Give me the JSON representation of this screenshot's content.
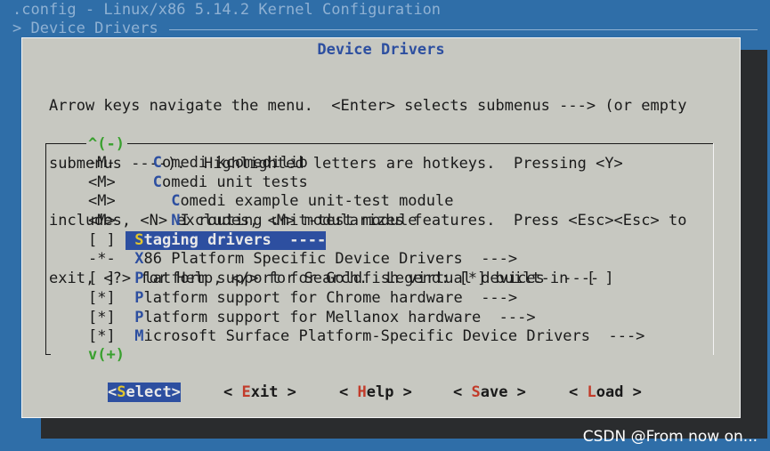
{
  "window": {
    "title": ".config - Linux/x86 5.14.2 Kernel Configuration",
    "breadcrumb": "> Device Drivers"
  },
  "dialog": {
    "title": "Device Drivers",
    "help_lines": [
      "Arrow keys navigate the menu.  <Enter> selects submenus ---> (or empty",
      "submenus ----).  Highlighted letters are hotkeys.  Pressing <Y>",
      "includes, <N> excludes, <M> modularizes features.  Press <Esc><Esc> to",
      "exit, <?> for Help, </> for Search.  Legend: [*] built-in  [ ]"
    ],
    "scroll_up": "^(-)",
    "scroll_down": "v(+)",
    "items": [
      {
        "symbol": "-M-",
        "indent": "   ",
        "hotkey": "C",
        "rest": "omedi kcomedilib",
        "selected": false
      },
      {
        "symbol": "<M>",
        "indent": "   ",
        "hotkey": "C",
        "rest": "omedi unit tests",
        "selected": false
      },
      {
        "symbol": "<M>",
        "indent": "     ",
        "hotkey": "C",
        "rest": "omedi example unit-test module",
        "selected": false
      },
      {
        "symbol": "<M>",
        "indent": "     ",
        "hotkey": "N",
        "rest": "I routing unit-test module",
        "selected": false
      },
      {
        "symbol": "[ ]",
        "indent": " ",
        "hotkey": "S",
        "rest": "taging drivers  ----",
        "selected": true
      },
      {
        "symbol": "-*-",
        "indent": " ",
        "hotkey": "X",
        "rest": "86 Platform Specific Device Drivers  --->",
        "selected": false
      },
      {
        "symbol": "[ ]",
        "indent": " ",
        "hotkey": "P",
        "rest": "latform support for Goldfish virtual devices  ----",
        "selected": false
      },
      {
        "symbol": "[*]",
        "indent": " ",
        "hotkey": "P",
        "rest": "latform support for Chrome hardware  --->",
        "selected": false
      },
      {
        "symbol": "[*]",
        "indent": " ",
        "hotkey": "P",
        "rest": "latform support for Mellanox hardware  --->",
        "selected": false
      },
      {
        "symbol": "[*]",
        "indent": " ",
        "hotkey": "M",
        "rest": "icrosoft Surface Platform-Specific Device Drivers  --->",
        "selected": false
      }
    ],
    "buttons": [
      {
        "pre": "<",
        "hotkey": "S",
        "post": "elect>",
        "selected": true
      },
      {
        "pre": "< ",
        "hotkey": "E",
        "post": "xit >",
        "selected": false
      },
      {
        "pre": "< ",
        "hotkey": "H",
        "post": "elp >",
        "selected": false
      },
      {
        "pre": "< ",
        "hotkey": "S",
        "post": "ave >",
        "selected": false
      },
      {
        "pre": "< ",
        "hotkey": "L",
        "post": "oad >",
        "selected": false
      }
    ]
  },
  "watermark": "CSDN @From now on...",
  "colors": {
    "background": "#2f6ea8",
    "dialog": "#c7c8c1",
    "title": "#2d4fa0",
    "hotkey": "#2d4fa0",
    "button_hotkey": "#c23b2a",
    "selected_hotkey": "#e2c52c",
    "scroll_indicator": "#39a02e"
  }
}
